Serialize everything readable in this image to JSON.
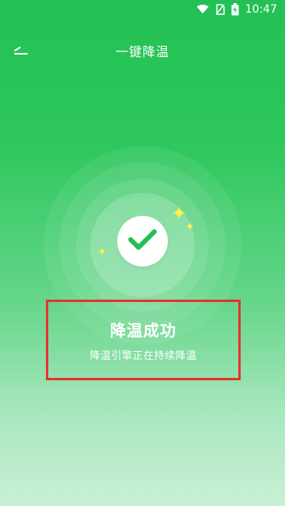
{
  "status_bar": {
    "time": "10:47",
    "icons": [
      "wifi-icon",
      "no-sim-icon",
      "battery-charging-icon"
    ]
  },
  "header": {
    "title": "一键降温",
    "back_icon": "back-arrow-icon"
  },
  "success": {
    "icon": "check-icon",
    "sparkle_icon": "sparkle-icon",
    "sparkle_color": "#fff34a"
  },
  "result": {
    "title": "降温成功",
    "subtitle": "降温引擎正在持续降温",
    "highlight_color": "#e8312f"
  },
  "colors": {
    "accent": "#23c155",
    "check": "#23c155",
    "text": "#ffffff"
  }
}
